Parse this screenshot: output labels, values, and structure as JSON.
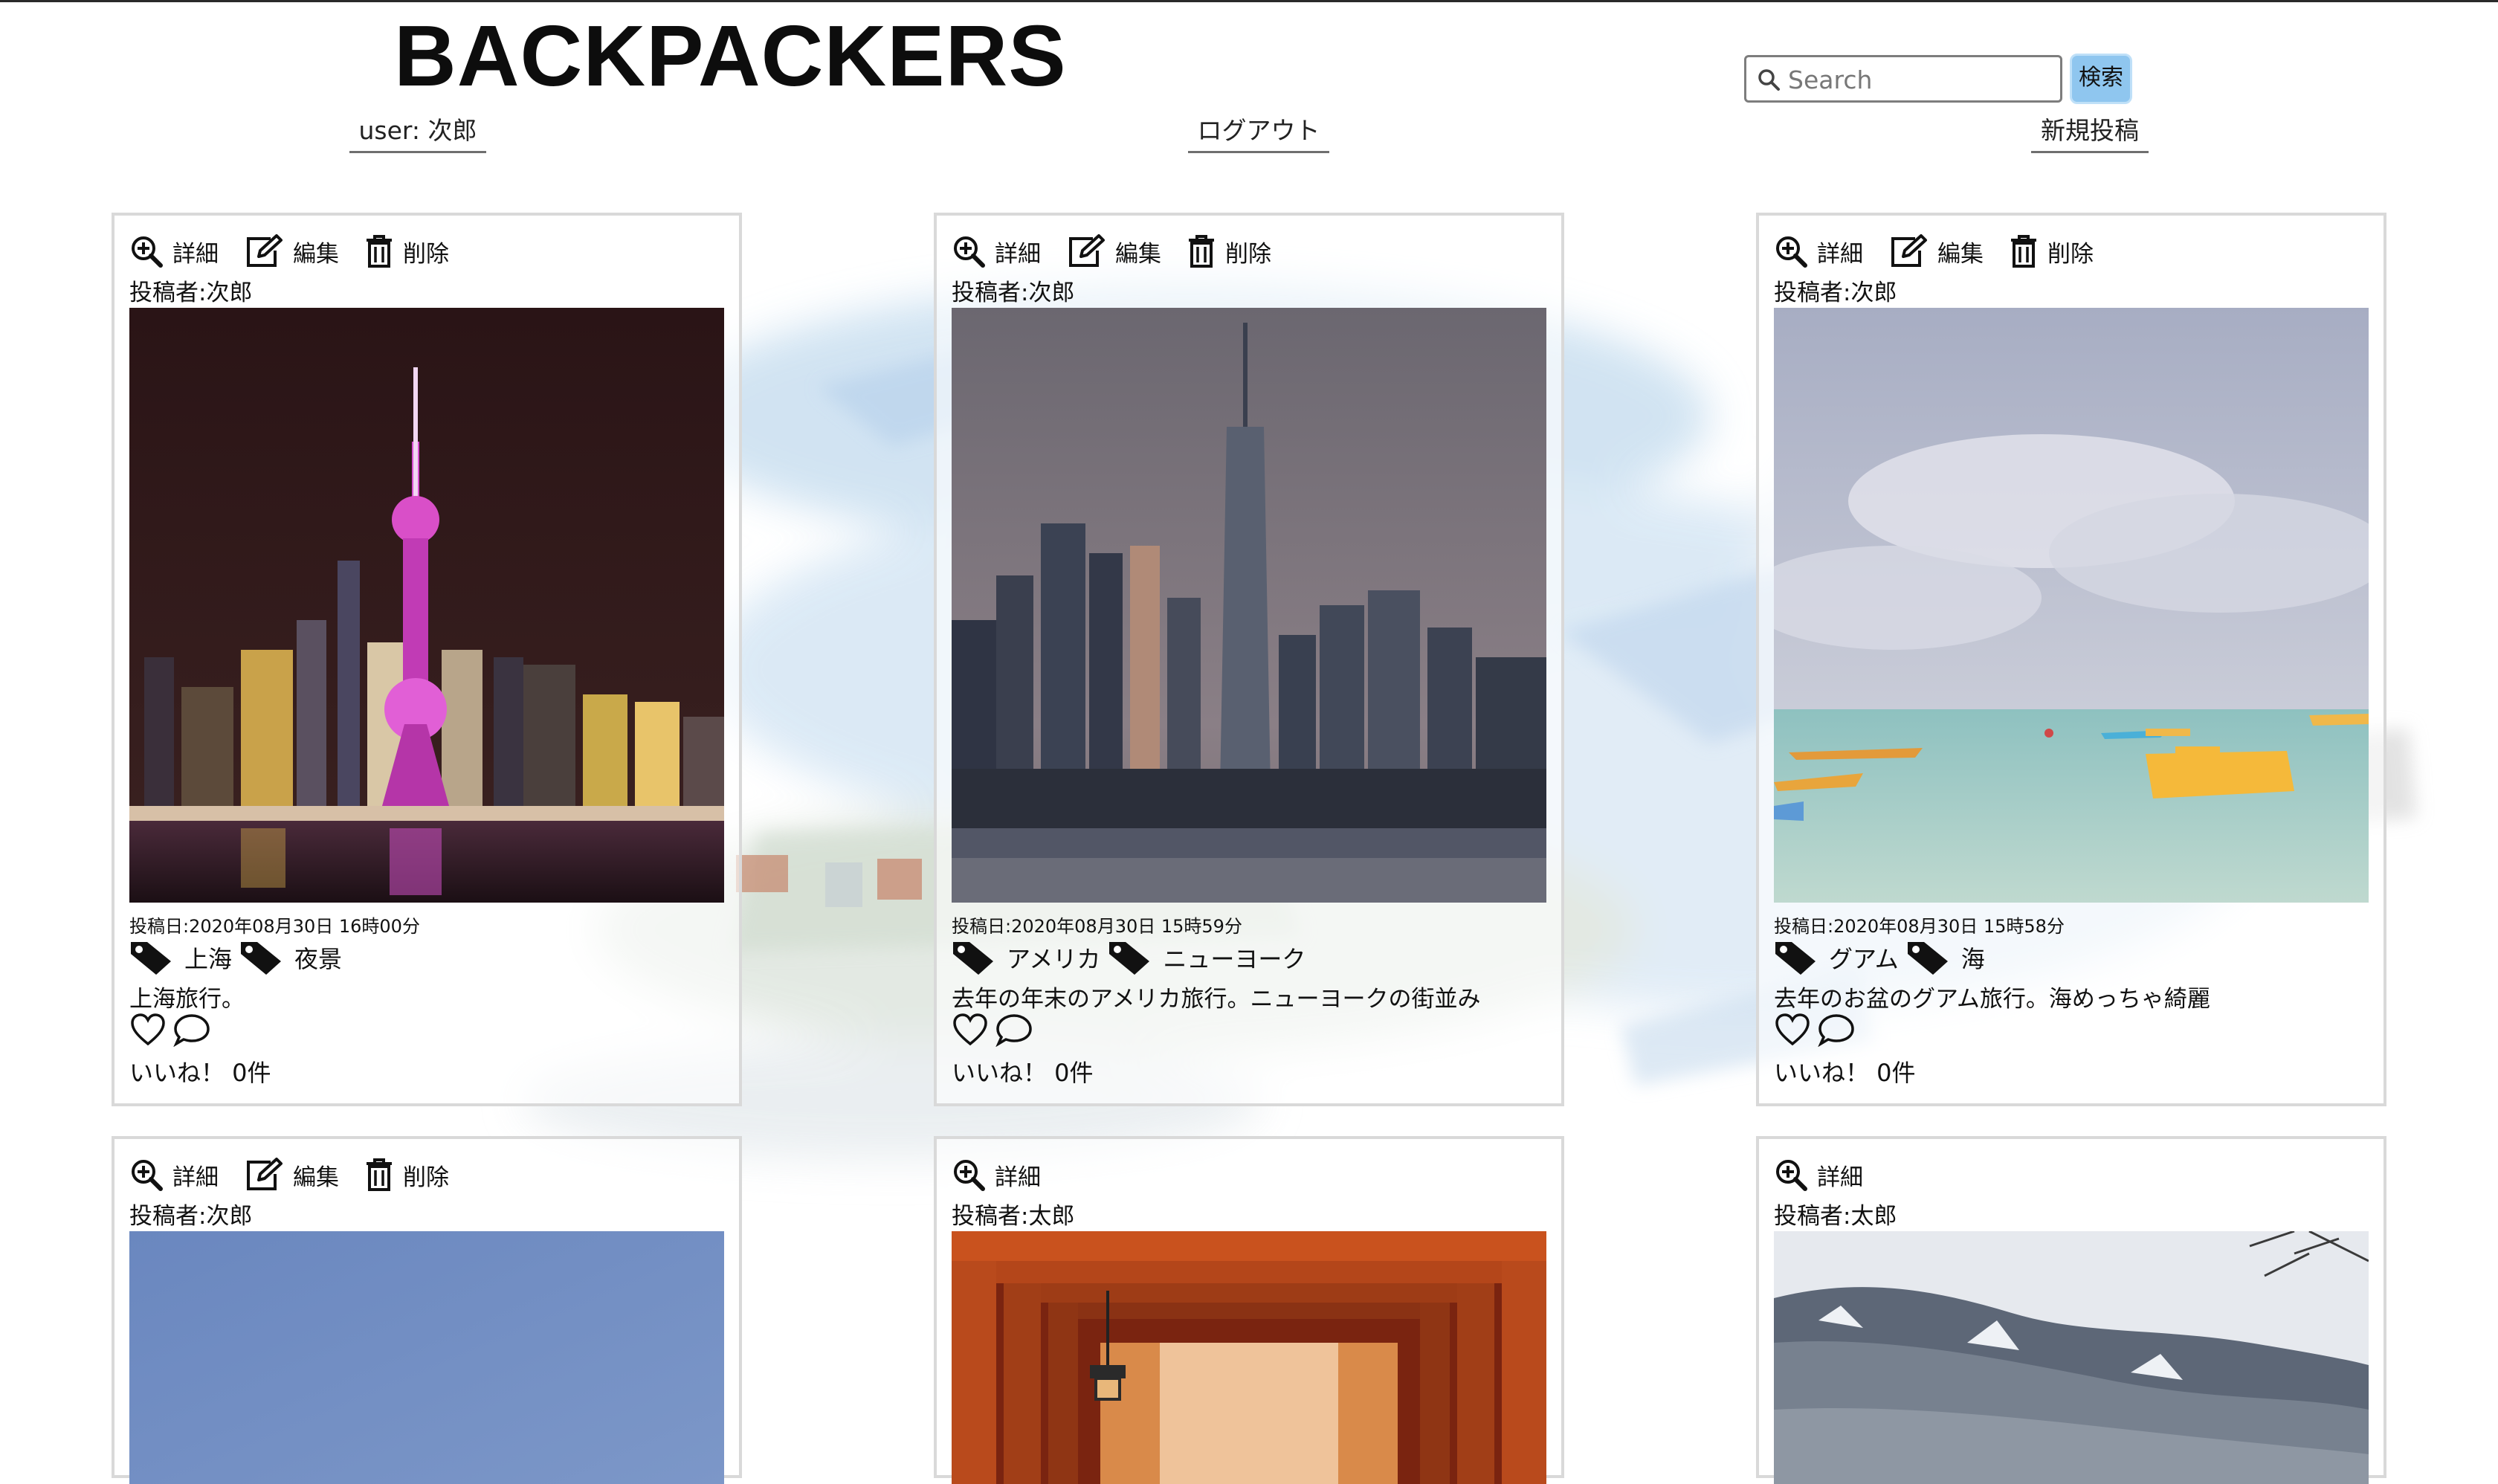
{
  "header": {
    "brand": "BACKPACKERS",
    "user_link": "user: 次郎",
    "logout_link": "ログアウト",
    "new_post_link": "新規投稿",
    "search": {
      "placeholder": "Search",
      "button_label": "検索",
      "icon": "search-icon"
    }
  },
  "actions": {
    "detail": "詳細",
    "edit": "編集",
    "delete": "削除"
  },
  "posts": [
    {
      "author": "投稿者:次郎",
      "date": "投稿日:2020年08月30日 16時00分",
      "tags": [
        "上海",
        "夜景"
      ],
      "caption": "上海旅行。",
      "likes": "いいね！ 0件",
      "photo": "night-skyline-tower"
    },
    {
      "author": "投稿者:次郎",
      "date": "投稿日:2020年08月30日 15時59分",
      "tags": [
        "アメリカ",
        "ニューヨーク"
      ],
      "caption": "去年の年末のアメリカ旅行。ニューヨークの街並み",
      "likes": "いいね！ 0件",
      "photo": "dusk-city-skyline"
    },
    {
      "author": "投稿者:次郎",
      "date": "投稿日:2020年08月30日 15時58分",
      "tags": [
        "グアム",
        "海"
      ],
      "caption": "去年のお盆のグアム旅行。海めっちゃ綺麗",
      "likes": "いいね！ 0件",
      "photo": "beach-pedal-boats"
    },
    {
      "author": "投稿者:次郎",
      "photo": "blue-sky"
    },
    {
      "author": "投稿者:太郎",
      "photo": "torii-gates"
    },
    {
      "author": "投稿者:太郎",
      "photo": "snowy-mountains"
    }
  ],
  "colors": {
    "search_button": "#8fc6ef",
    "card_border": "#d9d9d9"
  }
}
